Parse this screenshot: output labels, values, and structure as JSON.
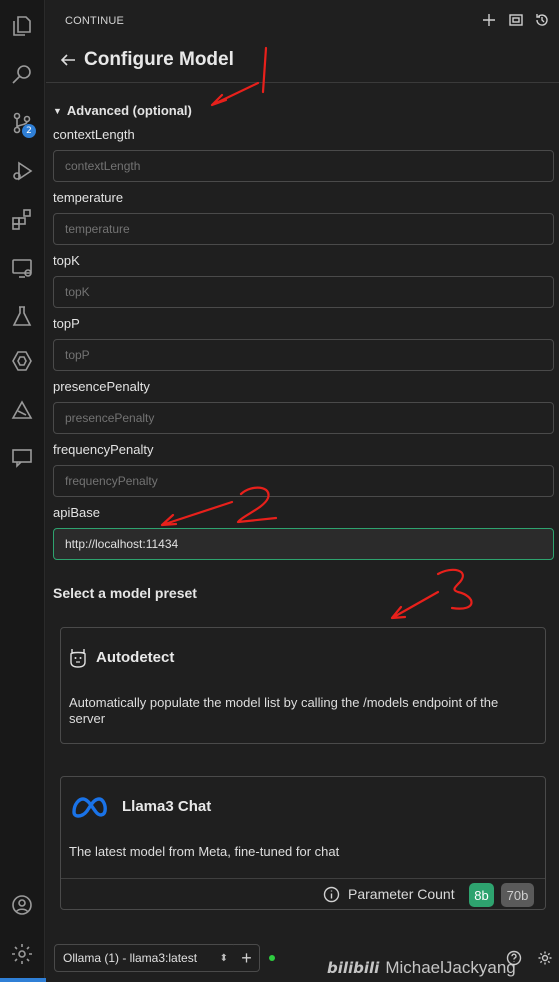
{
  "panel": {
    "title": "CONTINUE",
    "page_title": "Configure Model",
    "advanced_label": "Advanced (optional)"
  },
  "fields": [
    {
      "label": "contextLength",
      "placeholder": "contextLength",
      "value": ""
    },
    {
      "label": "temperature",
      "placeholder": "temperature",
      "value": ""
    },
    {
      "label": "topK",
      "placeholder": "topK",
      "value": ""
    },
    {
      "label": "topP",
      "placeholder": "topP",
      "value": ""
    },
    {
      "label": "presencePenalty",
      "placeholder": "presencePenalty",
      "value": ""
    },
    {
      "label": "frequencyPenalty",
      "placeholder": "frequencyPenalty",
      "value": ""
    },
    {
      "label": "apiBase",
      "placeholder": "",
      "value": "http://localhost:11434"
    }
  ],
  "presets": {
    "heading": "Select a model preset",
    "items": [
      {
        "title": "Autodetect",
        "icon": "llama-icon",
        "description": "Automatically populate the model list by calling the /models endpoint of the server"
      },
      {
        "title": "Llama3 Chat",
        "icon": "meta-logo",
        "description": "The latest model from Meta, fine-tuned for chat",
        "param_label": "Parameter Count",
        "param_options": [
          "8b",
          "70b"
        ],
        "selected": "8b"
      }
    ]
  },
  "activity_bar": {
    "icons": [
      "explorer-icon",
      "search-icon",
      "source-control-icon",
      "run-debug-icon",
      "extensions-icon",
      "remote-explorer-icon",
      "testing-icon",
      "continue-icon",
      "tools-icon",
      "chat-icon",
      "account-icon",
      "settings-icon"
    ],
    "source_control_badge": "2"
  },
  "footer": {
    "model_select": "Ollama (1) - llama3:latest",
    "add_label": "+"
  },
  "watermark": {
    "brand": "bilibili",
    "author": "MichaelJackyang"
  },
  "annotations": [
    "1",
    "2",
    "3"
  ],
  "colors": {
    "accent_green": "#2ea36f",
    "badge_blue": "#2f7fd6",
    "annotation_red": "#e8201b"
  }
}
